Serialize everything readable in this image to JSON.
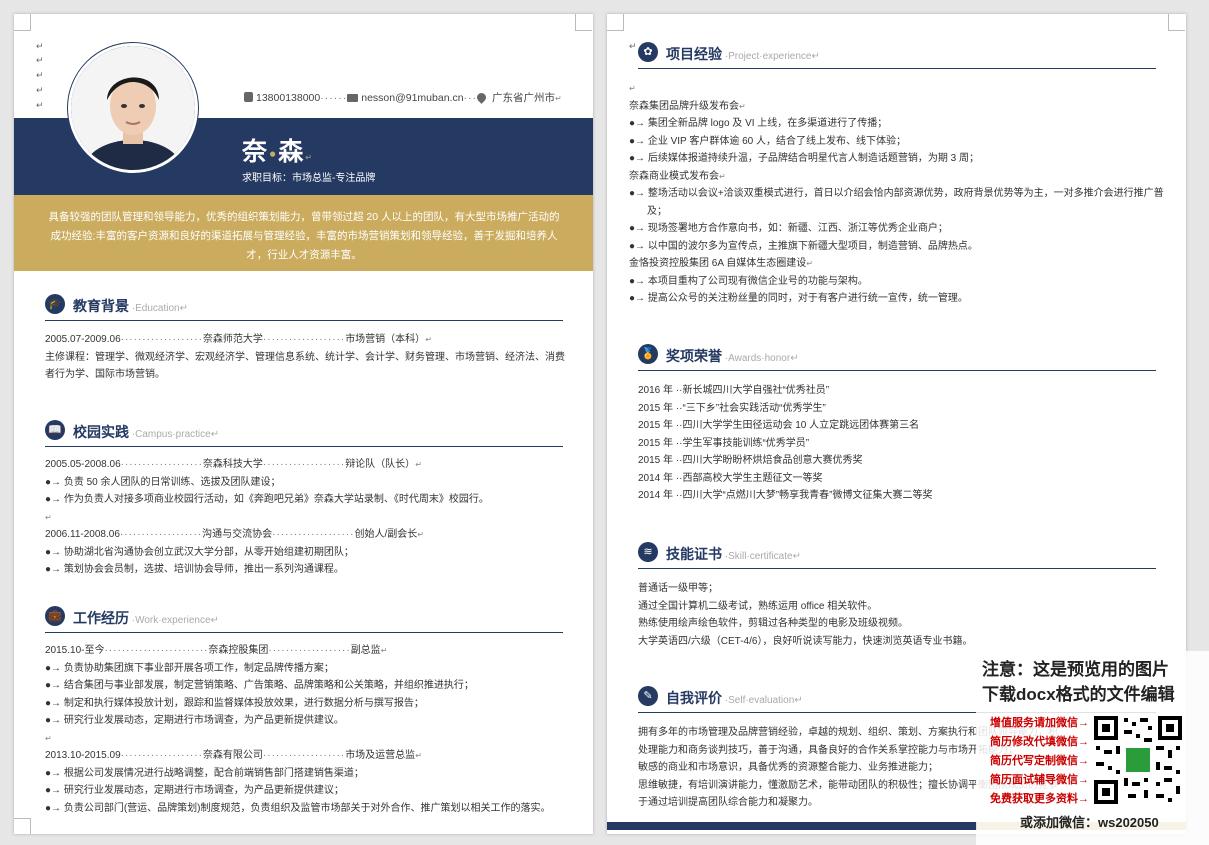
{
  "page1": {
    "contact": {
      "phone": "13800138000",
      "email": "nesson@91muban.cn",
      "location": "广东省广州市"
    },
    "name_first": "奈",
    "name_last": "森",
    "objective": "求职目标：市场总监-专注品牌",
    "summary": "具备较强的团队管理和领导能力，优秀的组织策划能力，曾带领过超 20 人以上的团队，有大型市场推广活动的成功经验;丰富的客户资源和良好的渠道拓展与管理经验，丰富的市场营销策划和领导经验，善于发掘和培养人才，行业人才资源丰富。",
    "education": {
      "title": "教育背景",
      "en": "Education",
      "period": "2005.07-2009.06",
      "school": "奈森师范大学",
      "major": "市场营销（本科）",
      "courses": "主修课程：管理学、微观经济学、宏观经济学、管理信息系统、统计学、会计学、财务管理、市场营销、经济法、消费者行为学、国际市场营销。"
    },
    "campus": {
      "title": "校园实践",
      "en": "Campus·practice",
      "items": [
        {
          "period": "2005.05-2008.06",
          "org": "奈森科技大学",
          "role": "辩论队（队长）",
          "bullets": [
            "负责 50 余人团队的日常训练、选拔及团队建设；",
            "作为负责人对接多项商业校园行活动，如《奔跑吧兄弟》奈森大学站录制、《时代周末》校园行。"
          ]
        },
        {
          "period": "2006.11-2008.06",
          "org": "沟通与交流协会",
          "role": "创始人/副会长",
          "bullets": [
            "协助湖北省沟通协会创立武汉大学分部，从零开始组建初期团队；",
            "策划协会会员制，选拔、培训协会导师，推出一系列沟通课程。"
          ]
        }
      ]
    },
    "work": {
      "title": "工作经历",
      "en": "Work·experience",
      "items": [
        {
          "period": "2015.10-至今",
          "org": "奈森控股集团",
          "role": "副总监",
          "bullets": [
            "负责协助集团旗下事业部开展各项工作，制定品牌传播方案；",
            "结合集团与事业部发展，制定营销策略、广告策略、品牌策略和公关策略，并组织推进执行；",
            "制定和执行媒体投放计划，跟踪和监督媒体投放效果，进行数据分析与撰写报告；",
            "研究行业发展动态，定期进行市场调查，为产品更新提供建议。"
          ]
        },
        {
          "period": "2013.10-2015.09",
          "org": "奈森有限公司",
          "role": "市场及运营总监",
          "bullets": [
            "根据公司发展情况进行战略调整，配合前端销售部门搭建销售渠道；",
            "研究行业发展动态，定期进行市场调查，为产品更新提供建议；",
            "负责公司部门(营运、品牌策划)制度规范，负责组织及监管市场部关于对外合作、推广策划以相关工作的落实。"
          ]
        }
      ]
    }
  },
  "page2": {
    "projects": {
      "title": "项目经验",
      "en": "Project·experience",
      "groups": [
        {
          "name": "奈森集团品牌升级发布会",
          "bullets": [
            "集团全新品牌 logo 及 VI 上线，在多渠道进行了传播；",
            "企业 VIP 客户群体逾 60 人，结合了线上发布、线下体验；",
            "后续媒体报道持续升温，子品牌结合明星代言人制造话题营销，为期 3 周；"
          ]
        },
        {
          "name": "奈森商业模式发布会",
          "bullets": [
            "整场活动以会议+洽谈双重模式进行，首日以介绍会恰内部资源优势，政府背景优势等为主，一对多推介会进行推广普及；",
            "现场签署地方合作意向书，如：新疆、江西、浙江等优秀企业商户；",
            "以中国的波尔多为宣传点，主推旗下新疆大型项目，制造营销、品牌热点。"
          ]
        },
        {
          "name": "金恪投资控股集团 6A 自媒体生态圈建设",
          "bullets": [
            "本项目重构了公司现有微信企业号的功能与架构。",
            "提高公众号的关注粉丝量的同时，对于有客户进行统一宣传，统一管理。"
          ]
        }
      ]
    },
    "awards": {
      "title": "奖项荣誉",
      "en": "Awards·honor",
      "items": [
        "2016 年 ··新长城四川大学自强社“优秀社员”",
        "2015 年 ··“三下乡”社会实践活动“优秀学生”",
        "2015 年 ··四川大学学生田径运动会 10 人立定跳远团体赛第三名",
        "2015 年 ··学生军事技能训练“优秀学员”",
        "2015 年 ··四川大学盼盼杯烘焙食品创意大赛优秀奖",
        "2014 年 ··西部高校大学生主题征文一等奖",
        "2014 年 ··四川大学“点燃川大梦”畅享我青春”微博文征集大赛二等奖"
      ]
    },
    "skills": {
      "title": "技能证书",
      "en": "Skill·certificate",
      "items": [
        "普通话一级甲等；",
        "通过全国计算机二级考试，熟练运用 office 相关软件。",
        "熟练使用绘声绘色软件，剪辑过各种类型的电影及班级视频。",
        "大学英语四/六级（CET-4/6），良好听说读写能力，快速浏览英语专业书籍。"
      ]
    },
    "self": {
      "title": "自我评价",
      "en": "Self·evaluation",
      "text": [
        "拥有多年的市场管理及品牌营销经验，卓越的规划、组织、策划、方案执行和团队领导能力，积",
        "处理能力和商务谈判技巧，善于沟通，具备良好的合作关系掌控能力与市场开拓能力；",
        "敏感的商业和市场意识，具备优秀的资源整合能力、业务推进能力；",
        "思维敏捷，有培训演讲能力，懂激励艺术，能带动团队的积极性；擅长协调平衡团队成员的竞争",
        "于通过培训提高团队综合能力和凝聚力。"
      ]
    }
  },
  "watermark": {
    "line1": "注意：这是预览用的图片",
    "line2": "下载docx格式的文件编辑",
    "links": [
      "增值服务请加微信→",
      "简历修改代填微信→",
      "简历代写定制微信→",
      "简历面试辅导微信→",
      "免费获取更多资料→"
    ],
    "wechat": "或添加微信：ws202050"
  },
  "colors": {
    "navy": "#253a62",
    "gold": "#cbac5e",
    "watermark_red": "#cc0000"
  },
  "icons": {
    "education": "graduation-cap-icon",
    "campus": "book-icon",
    "work": "briefcase-icon",
    "projects": "flower-icon",
    "awards": "medal-icon",
    "skills": "layers-icon",
    "self": "edit-icon"
  }
}
